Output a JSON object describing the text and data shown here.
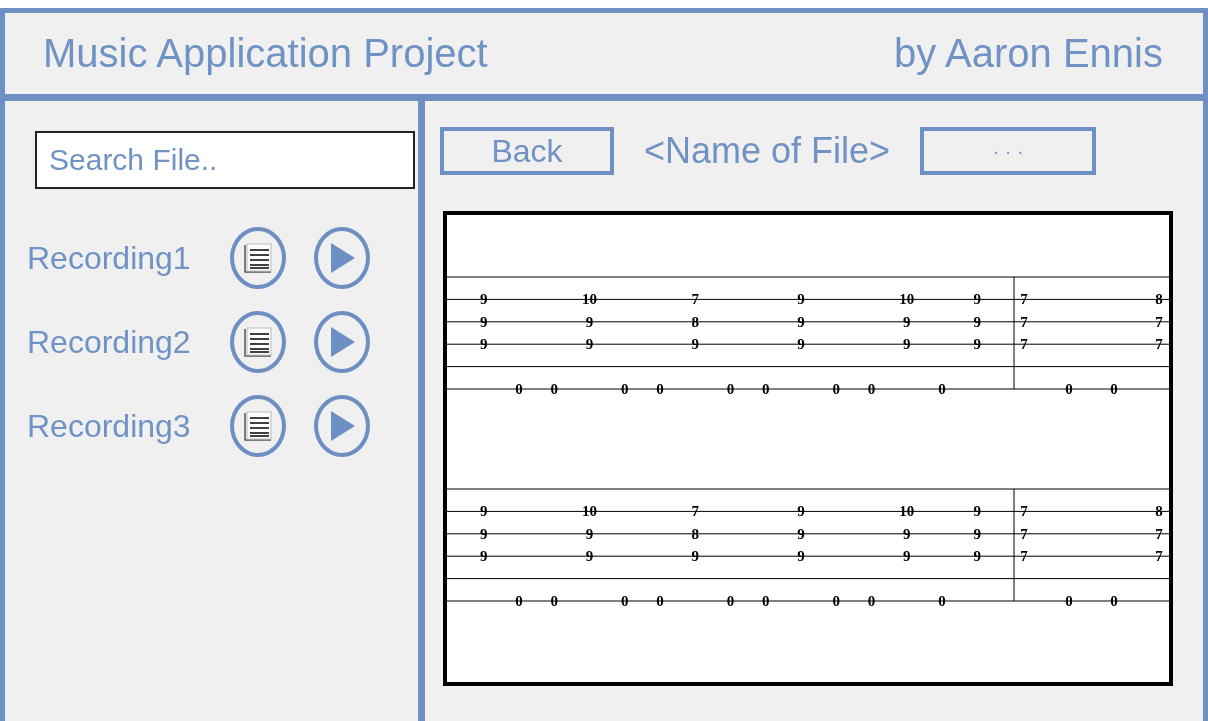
{
  "header": {
    "title": "Music Application Project",
    "author": "by Aaron Ennis"
  },
  "sidebar": {
    "search": {
      "placeholder": "Search File.."
    },
    "recordings": [
      {
        "name": "Recording1"
      },
      {
        "name": "Recording2"
      },
      {
        "name": "Recording3"
      }
    ]
  },
  "viewer": {
    "back_button": "Back",
    "file_name": "<Name of File>",
    "more_button": "· · ·",
    "tab": {
      "systems": [
        {
          "measures": [
            {
              "events": [
                {
                  "kind": "chord",
                  "frets": [
                    "9",
                    "9",
                    "9"
                  ]
                },
                {
                  "kind": "bass",
                  "frets": [
                    "0"
                  ]
                },
                {
                  "kind": "bass",
                  "frets": [
                    "0"
                  ]
                },
                {
                  "kind": "chord",
                  "frets": [
                    "10",
                    "9",
                    "9"
                  ]
                },
                {
                  "kind": "bass",
                  "frets": [
                    "0"
                  ]
                },
                {
                  "kind": "bass",
                  "frets": [
                    "0"
                  ]
                },
                {
                  "kind": "chord",
                  "frets": [
                    "7",
                    "8",
                    "9"
                  ]
                },
                {
                  "kind": "bass",
                  "frets": [
                    "0"
                  ]
                },
                {
                  "kind": "bass",
                  "frets": [
                    "0"
                  ]
                },
                {
                  "kind": "chord",
                  "frets": [
                    "9",
                    "9",
                    "9"
                  ]
                },
                {
                  "kind": "bass",
                  "frets": [
                    "0"
                  ]
                },
                {
                  "kind": "bass",
                  "frets": [
                    "0"
                  ]
                },
                {
                  "kind": "chord",
                  "frets": [
                    "10",
                    "9",
                    "9"
                  ]
                },
                {
                  "kind": "bass",
                  "frets": [
                    "0"
                  ]
                },
                {
                  "kind": "chord",
                  "frets": [
                    "9",
                    "9",
                    "9"
                  ]
                }
              ]
            },
            {
              "events": [
                {
                  "kind": "chord",
                  "frets": [
                    "7",
                    "7",
                    "7"
                  ]
                },
                {
                  "kind": "bass",
                  "frets": [
                    "0"
                  ]
                },
                {
                  "kind": "bass",
                  "frets": [
                    "0"
                  ]
                },
                {
                  "kind": "chord",
                  "frets": [
                    "8",
                    "7",
                    "7"
                  ]
                }
              ]
            }
          ]
        },
        {
          "measures": [
            {
              "events": [
                {
                  "kind": "chord",
                  "frets": [
                    "9",
                    "9",
                    "9"
                  ]
                },
                {
                  "kind": "bass",
                  "frets": [
                    "0"
                  ]
                },
                {
                  "kind": "bass",
                  "frets": [
                    "0"
                  ]
                },
                {
                  "kind": "chord",
                  "frets": [
                    "10",
                    "9",
                    "9"
                  ]
                },
                {
                  "kind": "bass",
                  "frets": [
                    "0"
                  ]
                },
                {
                  "kind": "bass",
                  "frets": [
                    "0"
                  ]
                },
                {
                  "kind": "chord",
                  "frets": [
                    "7",
                    "8",
                    "9"
                  ]
                },
                {
                  "kind": "bass",
                  "frets": [
                    "0"
                  ]
                },
                {
                  "kind": "bass",
                  "frets": [
                    "0"
                  ]
                },
                {
                  "kind": "chord",
                  "frets": [
                    "9",
                    "9",
                    "9"
                  ]
                },
                {
                  "kind": "bass",
                  "frets": [
                    "0"
                  ]
                },
                {
                  "kind": "bass",
                  "frets": [
                    "0"
                  ]
                },
                {
                  "kind": "chord",
                  "frets": [
                    "10",
                    "9",
                    "9"
                  ]
                },
                {
                  "kind": "bass",
                  "frets": [
                    "0"
                  ]
                },
                {
                  "kind": "chord",
                  "frets": [
                    "9",
                    "9",
                    "9"
                  ]
                }
              ]
            },
            {
              "events": [
                {
                  "kind": "chord",
                  "frets": [
                    "7",
                    "7",
                    "7"
                  ]
                },
                {
                  "kind": "bass",
                  "frets": [
                    "0"
                  ]
                },
                {
                  "kind": "bass",
                  "frets": [
                    "0"
                  ]
                },
                {
                  "kind": "chord",
                  "frets": [
                    "8",
                    "7",
                    "7"
                  ]
                }
              ]
            }
          ]
        }
      ]
    }
  }
}
